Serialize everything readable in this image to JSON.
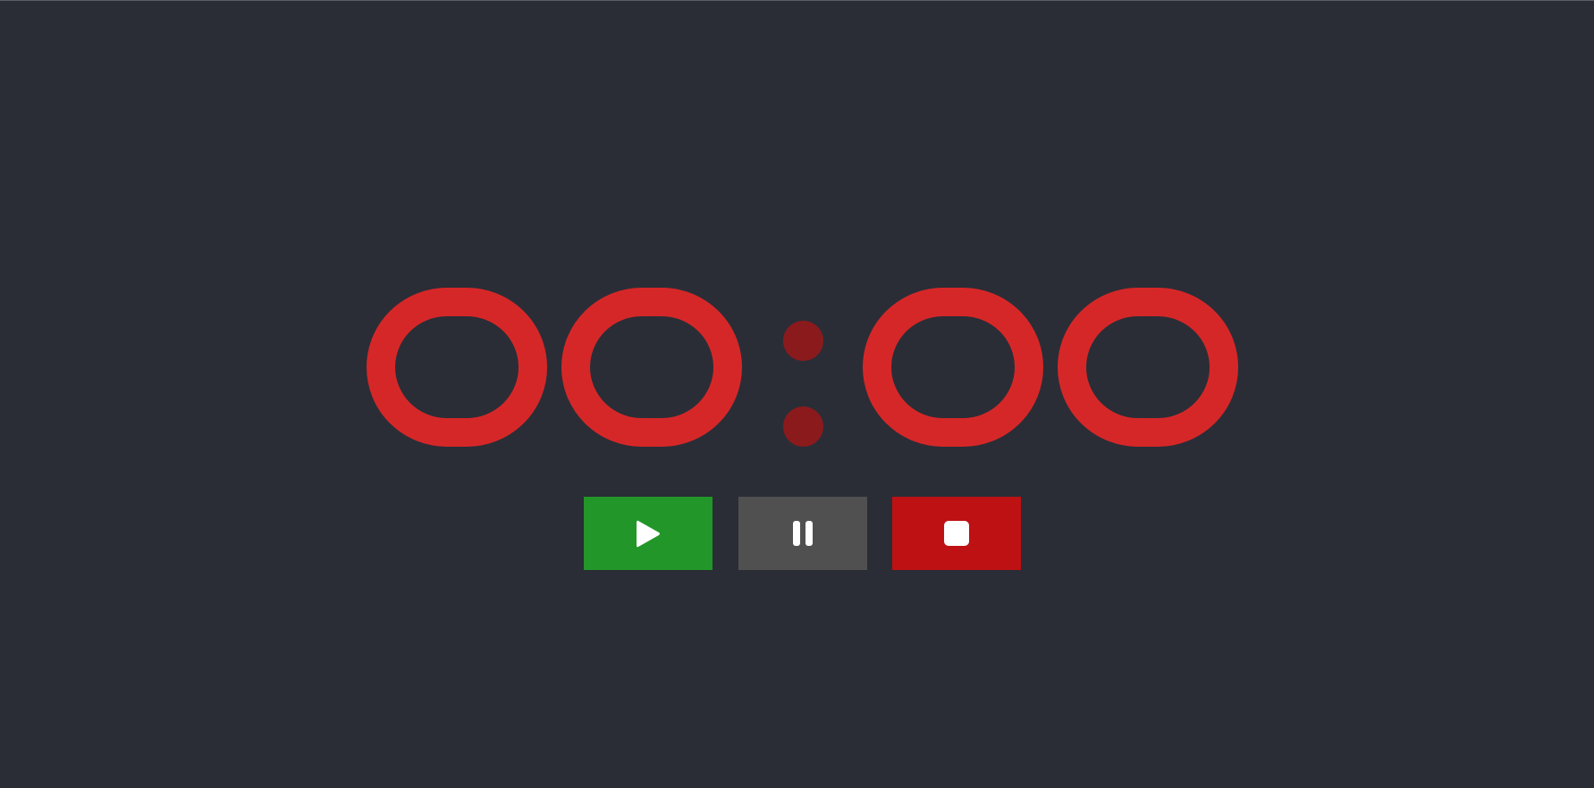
{
  "timer": {
    "display": "00:00",
    "digits": [
      "0",
      "0",
      "0",
      "0"
    ]
  },
  "colors": {
    "background": "#2a2d36",
    "digit": "#d62728",
    "colon": "#8b1a1d",
    "play": "#229628",
    "pause": "#505050",
    "stop": "#bd1114",
    "icon": "#ffffff"
  },
  "controls": {
    "play": {
      "icon": "play-icon"
    },
    "pause": {
      "icon": "pause-icon"
    },
    "stop": {
      "icon": "stop-icon"
    }
  }
}
